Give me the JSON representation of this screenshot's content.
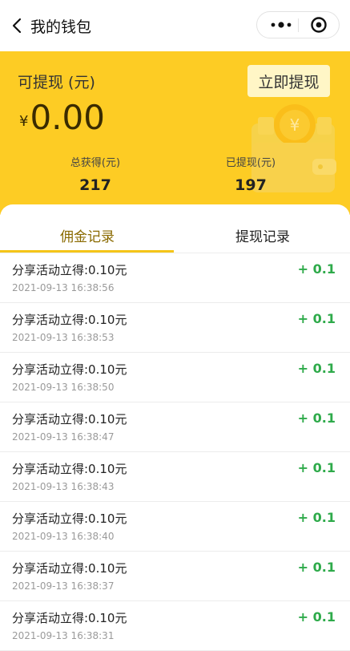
{
  "nav": {
    "title": "我的钱包"
  },
  "hero": {
    "available_label": "可提现 (元)",
    "currency": "¥",
    "amount": "0.00",
    "withdraw_button": "立即提现",
    "total_label": "总获得(元)",
    "total_value": "217",
    "withdrawn_label": "已提现(元)",
    "withdrawn_value": "197"
  },
  "tabs": {
    "commission": "佣金记录",
    "withdraw": "提现记录"
  },
  "records": [
    {
      "title": "分享活动立得:0.10元",
      "time": "2021-09-13 16:38:56",
      "amount": "+ 0.1"
    },
    {
      "title": "分享活动立得:0.10元",
      "time": "2021-09-13 16:38:53",
      "amount": "+ 0.1"
    },
    {
      "title": "分享活动立得:0.10元",
      "time": "2021-09-13 16:38:50",
      "amount": "+ 0.1"
    },
    {
      "title": "分享活动立得:0.10元",
      "time": "2021-09-13 16:38:47",
      "amount": "+ 0.1"
    },
    {
      "title": "分享活动立得:0.10元",
      "time": "2021-09-13 16:38:43",
      "amount": "+ 0.1"
    },
    {
      "title": "分享活动立得:0.10元",
      "time": "2021-09-13 16:38:40",
      "amount": "+ 0.1"
    },
    {
      "title": "分享活动立得:0.10元",
      "time": "2021-09-13 16:38:37",
      "amount": "+ 0.1"
    },
    {
      "title": "分享活动立得:0.10元",
      "time": "2021-09-13 16:38:31",
      "amount": "+ 0.1"
    }
  ],
  "icons": {
    "back": "chevron-left-icon",
    "more": "more-dots-icon",
    "close": "target-close-icon",
    "wallet": "wallet-coin-icon"
  },
  "colors": {
    "header": "#fdcc24",
    "accent_amount": "#2eaa4a",
    "tab_active": "#8a6a00"
  }
}
